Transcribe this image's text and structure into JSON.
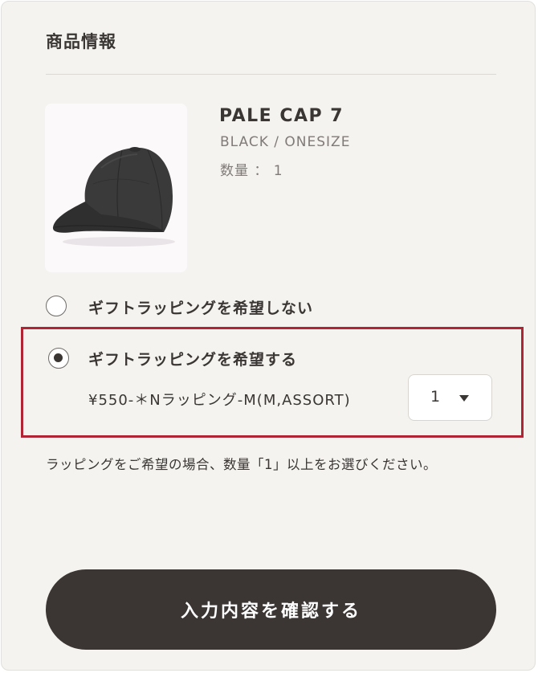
{
  "section": {
    "title": "商品情報"
  },
  "product": {
    "name": "PALE CAP 7",
    "variant": "BLACK / ONESIZE",
    "quantity": "数量 ： 1"
  },
  "gift_wrapping": {
    "option_no": "ギフトラッピングを希望しない",
    "option_yes": "ギフトラッピングを希望する",
    "selected": "option_yes",
    "wrap_product": "¥550-＊Nラッピング-M(M,ASSORT)",
    "qty_selected": "1"
  },
  "note": "ラッピングをご希望の場合、数量「1」以上をお選びください。",
  "confirm_button": "入力内容を確認する",
  "colors": {
    "background": "#f4f3f0",
    "text": "#3a3634",
    "muted_text": "#807b78",
    "highlight_border": "#b02434",
    "button": "#3b3634"
  }
}
